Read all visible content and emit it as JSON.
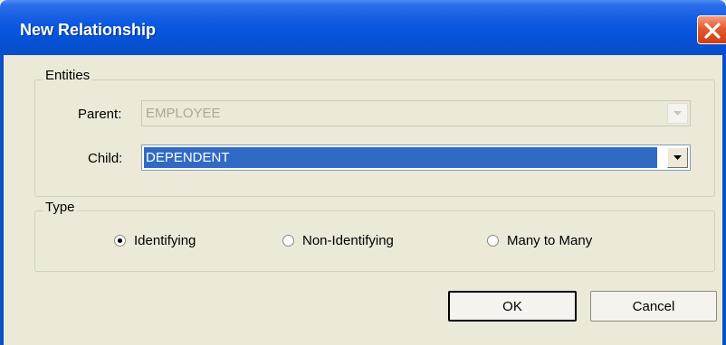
{
  "window": {
    "title": "New Relationship"
  },
  "entities": {
    "group_label": "Entities",
    "parent": {
      "label": "Parent:",
      "value": "EMPLOYEE",
      "enabled": false
    },
    "child": {
      "label": "Child:",
      "value": "DEPENDENT",
      "enabled": true
    }
  },
  "type": {
    "group_label": "Type",
    "options": [
      {
        "label": "Identifying",
        "checked": true
      },
      {
        "label": "Non-Identifying",
        "checked": false
      },
      {
        "label": "Many to Many",
        "checked": false
      }
    ]
  },
  "buttons": {
    "ok": "OK",
    "cancel": "Cancel"
  },
  "colors": {
    "titlebar": "#0a58e0",
    "selection": "#316ac5",
    "face": "#ece9d8",
    "close": "#e35a31"
  }
}
